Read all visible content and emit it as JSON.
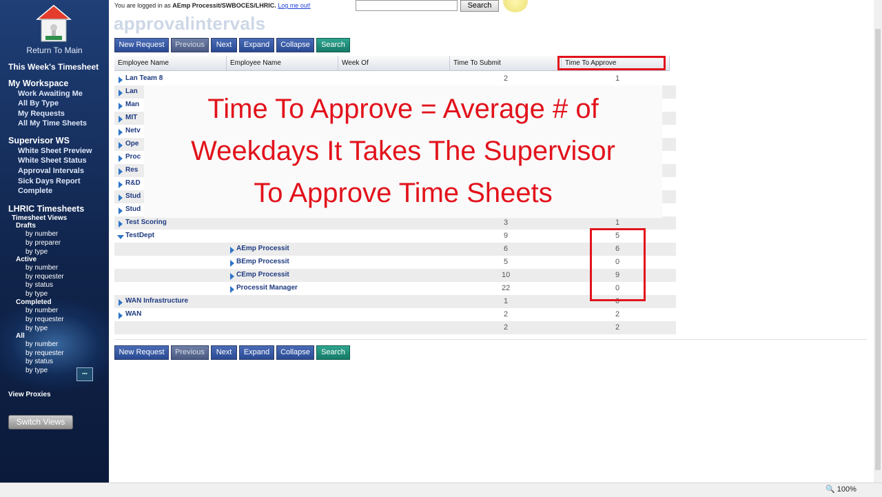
{
  "sidebar": {
    "return_to_main": "Return To Main",
    "this_weeks_timesheet": "This Week's Timesheet",
    "my_workspace": "My Workspace",
    "my_workspace_items": [
      "Work Awaiting Me",
      "All By Type",
      "My Requests",
      "All My Time Sheets"
    ],
    "supervisor_ws": "Supervisor WS",
    "supervisor_items": [
      "White Sheet Preview",
      "White Sheet Status",
      "Approval Intervals",
      "Sick Days Report",
      "Complete"
    ],
    "lhric_timesheets": "LHRIC Timesheets",
    "timesheet_views": "Timesheet Views",
    "drafts": "Drafts",
    "drafts_items": [
      "by number",
      "by preparer",
      "by type"
    ],
    "active": "Active",
    "active_items": [
      "by number",
      "by requester",
      "by status",
      "by type"
    ],
    "completed": "Completed",
    "completed_items": [
      "by number",
      "by requester",
      "by type"
    ],
    "all": "All",
    "all_items": [
      "by number",
      "by requester",
      "by status",
      "by type"
    ],
    "view_proxies": "View Proxies",
    "switch_views": "Switch Views"
  },
  "topbar": {
    "logged_in_prefix": "You are logged in as",
    "user": "AEmp Processit/SWBOCES/LHRIC.",
    "logout": "Log me out!",
    "search_button": "Search"
  },
  "page_title": "approvalintervals",
  "toolbar": [
    "New Request",
    "Previous",
    "Next",
    "Expand",
    "Collapse",
    "Search"
  ],
  "columns": [
    "Employee Name",
    "Employee Name",
    "Week Of",
    "Time To Submit",
    "Time To Approve"
  ],
  "rows": [
    {
      "name": "Lan Team 8",
      "submit": "2",
      "approve": "1"
    },
    {
      "name": "Lan",
      "submit": "",
      "approve": ""
    },
    {
      "name": "Man",
      "submit": "",
      "approve": ""
    },
    {
      "name": "MIT",
      "submit": "",
      "approve": ""
    },
    {
      "name": "Netv",
      "submit": "",
      "approve": ""
    },
    {
      "name": "Ope",
      "submit": "",
      "approve": ""
    },
    {
      "name": "Proc",
      "submit": "",
      "approve": ""
    },
    {
      "name": "Res",
      "submit": "",
      "approve": ""
    },
    {
      "name": "R&D",
      "submit": "",
      "approve": ""
    },
    {
      "name": "Stud",
      "submit": "",
      "approve": ""
    },
    {
      "name": "Stud",
      "submit": "",
      "approve": ""
    },
    {
      "name": "Test Scoring",
      "submit": "3",
      "approve": "1"
    },
    {
      "name": "TestDept",
      "submit": "9",
      "approve": "5"
    },
    {
      "sub": "AEmp Processit",
      "submit": "6",
      "approve": "6"
    },
    {
      "sub": "BEmp Processit",
      "submit": "5",
      "approve": "0"
    },
    {
      "sub": "CEmp Processit",
      "submit": "10",
      "approve": "9"
    },
    {
      "sub": "Processit Manager",
      "submit": "22",
      "approve": "0"
    },
    {
      "name": "WAN Infrastructure",
      "submit": "1",
      "approve": "0"
    },
    {
      "name": "WAN",
      "submit": "2",
      "approve": "2"
    },
    {
      "name": "",
      "submit": "2",
      "approve": "2"
    }
  ],
  "overlay": {
    "line1": "Time To Approve = Average # of",
    "line2": "Weekdays It Takes The Supervisor",
    "line3": "To Approve Time Sheets"
  },
  "status": {
    "zoom": "100%"
  },
  "colors": {
    "highlight": "#e2121b",
    "sidebar": "#14305e",
    "link": "#1e3a80"
  }
}
